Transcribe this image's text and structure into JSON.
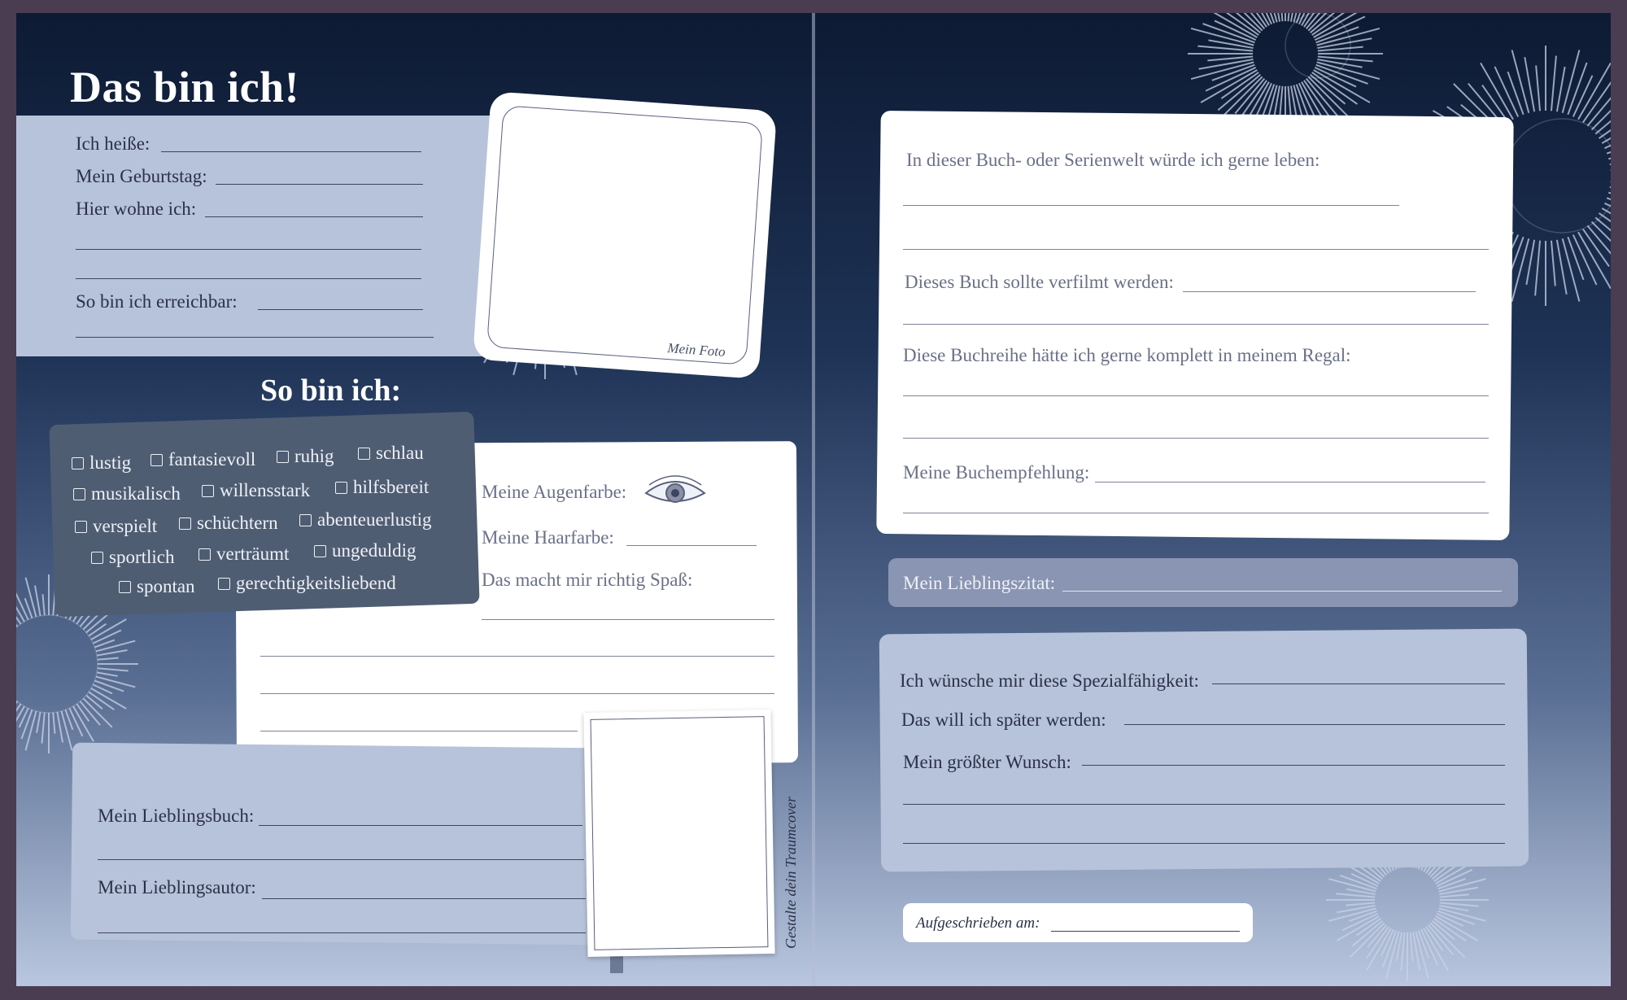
{
  "left": {
    "title": "Das bin ich!",
    "contact": {
      "name_label": "Ich heiße:",
      "birthday_label": "Mein Geburtstag:",
      "home_label": "Hier wohne ich:",
      "reach_label": "So bin ich erreichbar:"
    },
    "photo_caption": "Mein Foto",
    "traits_title": "So bin ich:",
    "traits": [
      "lustig",
      "fantasievoll",
      "ruhig",
      "schlau",
      "musikalisch",
      "willensstark",
      "hilfsbereit",
      "verspielt",
      "schüchtern",
      "abenteuerlustig",
      "sportlich",
      "verträumt",
      "ungeduldig",
      "spontan",
      "gerechtigkeitsliebend"
    ],
    "looks": {
      "eyes_label": "Meine Augenfarbe:",
      "hair_label": "Meine Haarfarbe:",
      "fun_label": "Das macht mir richtig Spaß:"
    },
    "favorites": {
      "book_label": "Mein Lieblingsbuch:",
      "author_label": "Mein Lieblingsautor:"
    },
    "cover_caption": "Gestalte dein Traumcover"
  },
  "right": {
    "world_label": "In dieser Buch- oder Serienwelt würde ich gerne leben:",
    "film_label": "Dieses Buch sollte verfilmt werden:",
    "series_label": "Diese Buchreihe hätte ich gerne komplett in meinem Regal:",
    "recommend_label": "Meine Buchempfehlung:",
    "quote_label": "Mein Lieblingszitat:",
    "power_label": "Ich wünsche mir diese Spezialfähigkeit:",
    "career_label": "Das will ich später werden:",
    "wish_label": "Mein größter Wunsch:",
    "written_label": "Aufgeschrieben am:"
  }
}
